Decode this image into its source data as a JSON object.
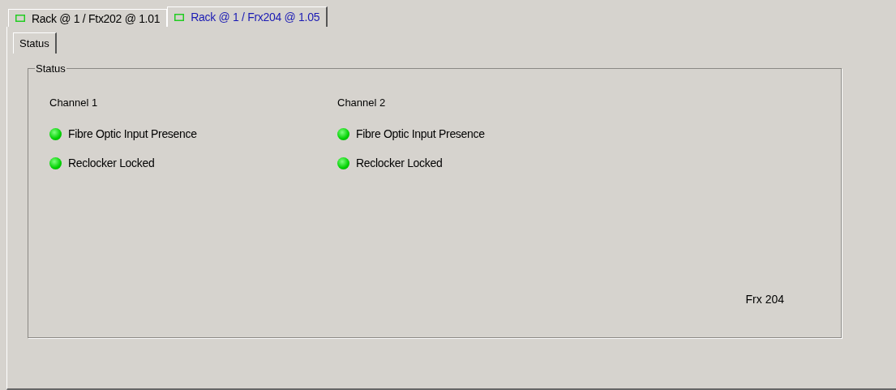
{
  "document_tabs": [
    {
      "label": "Rack @ 1 / Ftx202 @ 1.01",
      "selected": false
    },
    {
      "label": "Rack @ 1 / Frx204 @ 1.05",
      "selected": true
    }
  ],
  "inner_tabs": [
    {
      "label": "Status",
      "selected": true
    }
  ],
  "status_group": {
    "title": "Status",
    "channels": [
      {
        "name": "Channel 1",
        "indicators": [
          {
            "label": "Fibre Optic Input Presence",
            "on": true
          },
          {
            "label": "Reclocker Locked",
            "on": true
          }
        ]
      },
      {
        "name": "Channel 2",
        "indicators": [
          {
            "label": "Fibre Optic Input Presence",
            "on": true
          },
          {
            "label": "Reclocker Locked",
            "on": true
          }
        ]
      }
    ],
    "device_label": "Frx 204"
  }
}
